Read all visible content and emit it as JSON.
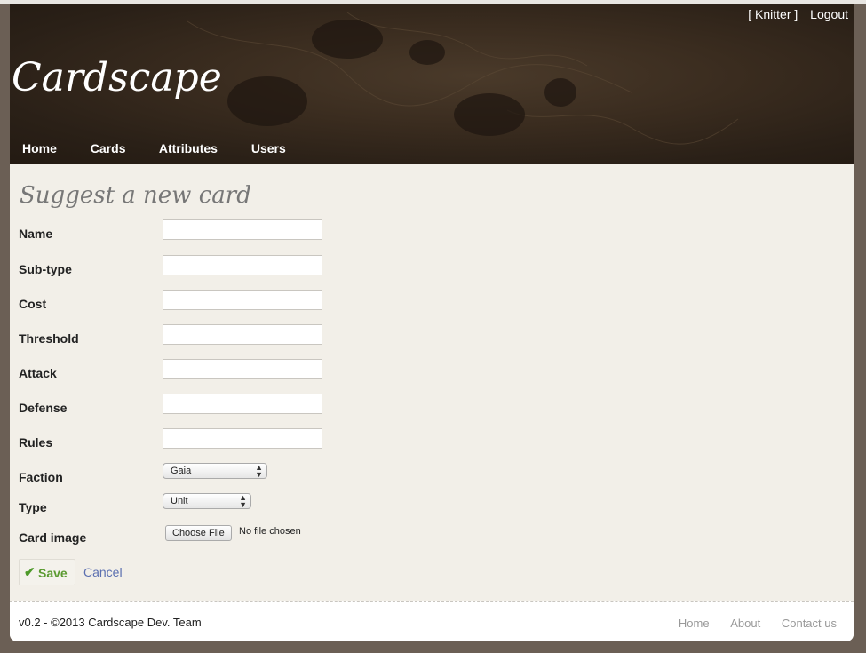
{
  "user_bar": {
    "username": "[ Knitter ]",
    "logout": "Logout"
  },
  "logo": "Cardscape",
  "nav": {
    "home": "Home",
    "cards": "Cards",
    "attributes": "Attributes",
    "users": "Users"
  },
  "page_title": "Suggest a new card",
  "form": {
    "name_label": "Name",
    "subtype_label": "Sub-type",
    "cost_label": "Cost",
    "threshold_label": "Threshold",
    "attack_label": "Attack",
    "defense_label": "Defense",
    "rules_label": "Rules",
    "faction_label": "Faction",
    "faction_value": "Gaia",
    "type_label": "Type",
    "type_value": "Unit",
    "card_image_label": "Card image",
    "choose_file_label": "Choose File",
    "no_file_text": "No file chosen",
    "save_label": "Save",
    "cancel_label": "Cancel"
  },
  "footer": {
    "copyright": "v0.2 - ©2013 Cardscape Dev. Team",
    "home": "Home",
    "about": "About",
    "contact": "Contact us"
  },
  "colors": {
    "header_bg": "#2a2017",
    "content_bg": "#f2efe8",
    "save_green": "#5a9a30",
    "link_blue": "#5b6fb0"
  }
}
